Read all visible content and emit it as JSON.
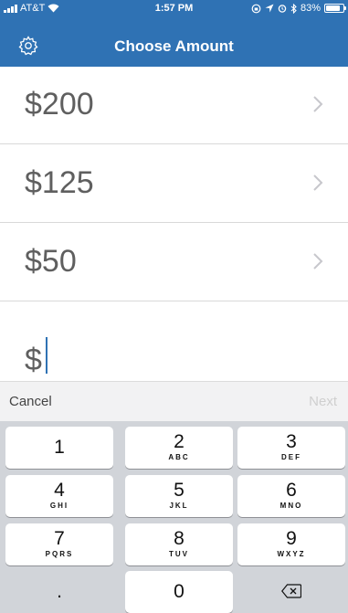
{
  "status_bar": {
    "carrier": "AT&T",
    "time": "1:57 PM",
    "battery_text": "83%",
    "battery_level": 0.83
  },
  "header": {
    "title": "Choose Amount",
    "settings_icon": "gear-icon"
  },
  "amounts": [
    {
      "label": "$200"
    },
    {
      "label": "$125"
    },
    {
      "label": "$50"
    }
  ],
  "custom_amount": {
    "symbol": "$",
    "value": ""
  },
  "accessory_bar": {
    "cancel": "Cancel",
    "next": "Next"
  },
  "keypad": {
    "keys": [
      {
        "digit": "1",
        "letters": ""
      },
      {
        "digit": "2",
        "letters": "ABC"
      },
      {
        "digit": "3",
        "letters": "DEF"
      },
      {
        "digit": "4",
        "letters": "GHI"
      },
      {
        "digit": "5",
        "letters": "JKL"
      },
      {
        "digit": "6",
        "letters": "MNO"
      },
      {
        "digit": "7",
        "letters": "PQRS"
      },
      {
        "digit": "8",
        "letters": "TUV"
      },
      {
        "digit": "9",
        "letters": "WXYZ"
      },
      {
        "digit": ".",
        "letters": ""
      },
      {
        "digit": "0",
        "letters": ""
      }
    ],
    "delete_icon": "backspace-icon"
  },
  "colors": {
    "header_bg": "#2f72b4",
    "keypad_bg": "#d1d4d9",
    "amount_text": "#5f5f5f",
    "disabled_text": "#cfcfcf"
  }
}
